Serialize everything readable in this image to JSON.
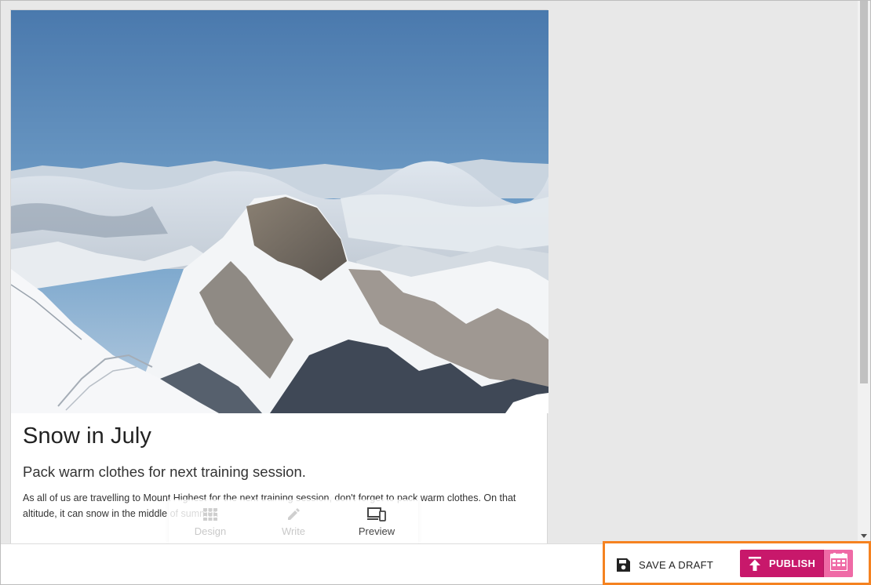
{
  "post": {
    "title": "Snow in July",
    "subtitle": "Pack warm clothes for next training session.",
    "body": "As all of us are travelling to Mount Highest for the next training session, don't forget to pack warm clothes. On that altitude, it can snow in the middle of summer."
  },
  "modes": [
    {
      "label": "Design",
      "icon": "grid-icon",
      "active": false
    },
    {
      "label": "Write",
      "icon": "pencil-icon",
      "active": false
    },
    {
      "label": "Preview",
      "icon": "devices-icon",
      "active": true
    }
  ],
  "actions": {
    "save_label": "SAVE A DRAFT",
    "publish_label": "PUBLISH",
    "schedule_icon": "calendar-icon"
  },
  "colors": {
    "publish": "#c8186b",
    "schedule": "#ef6aa6",
    "highlight": "#f58220"
  }
}
